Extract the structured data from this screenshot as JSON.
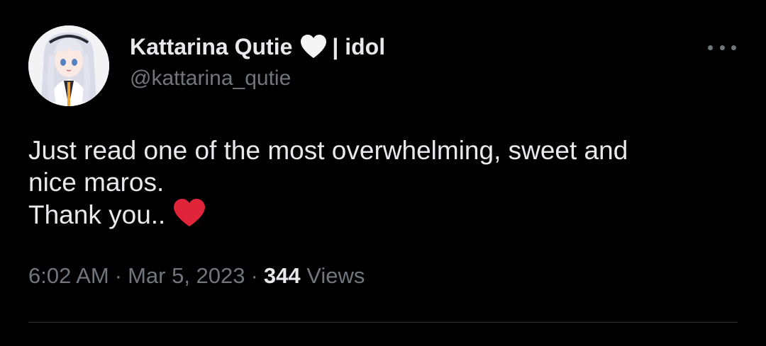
{
  "author": {
    "display_name": "Kattarina Qutie",
    "name_suffix": "| idol",
    "handle": "@kattarina_qutie",
    "name_emoji": "white-heart-icon",
    "avatar": "anime-avatar"
  },
  "tweet": {
    "lines": [
      "Just read one of the most overwhelming, sweet and",
      "nice maros.",
      "Thank you.."
    ],
    "trailing_emoji": "red-heart-icon"
  },
  "meta": {
    "time": "6:02 AM",
    "date": "Mar 5, 2023",
    "separator": "·",
    "views_count": "344",
    "views_label": "Views"
  },
  "colors": {
    "background": "#000000",
    "primary_text": "#e7e9ea",
    "secondary_text": "#71767b",
    "heart_red": "#e0243a",
    "divider": "#2f3336"
  }
}
